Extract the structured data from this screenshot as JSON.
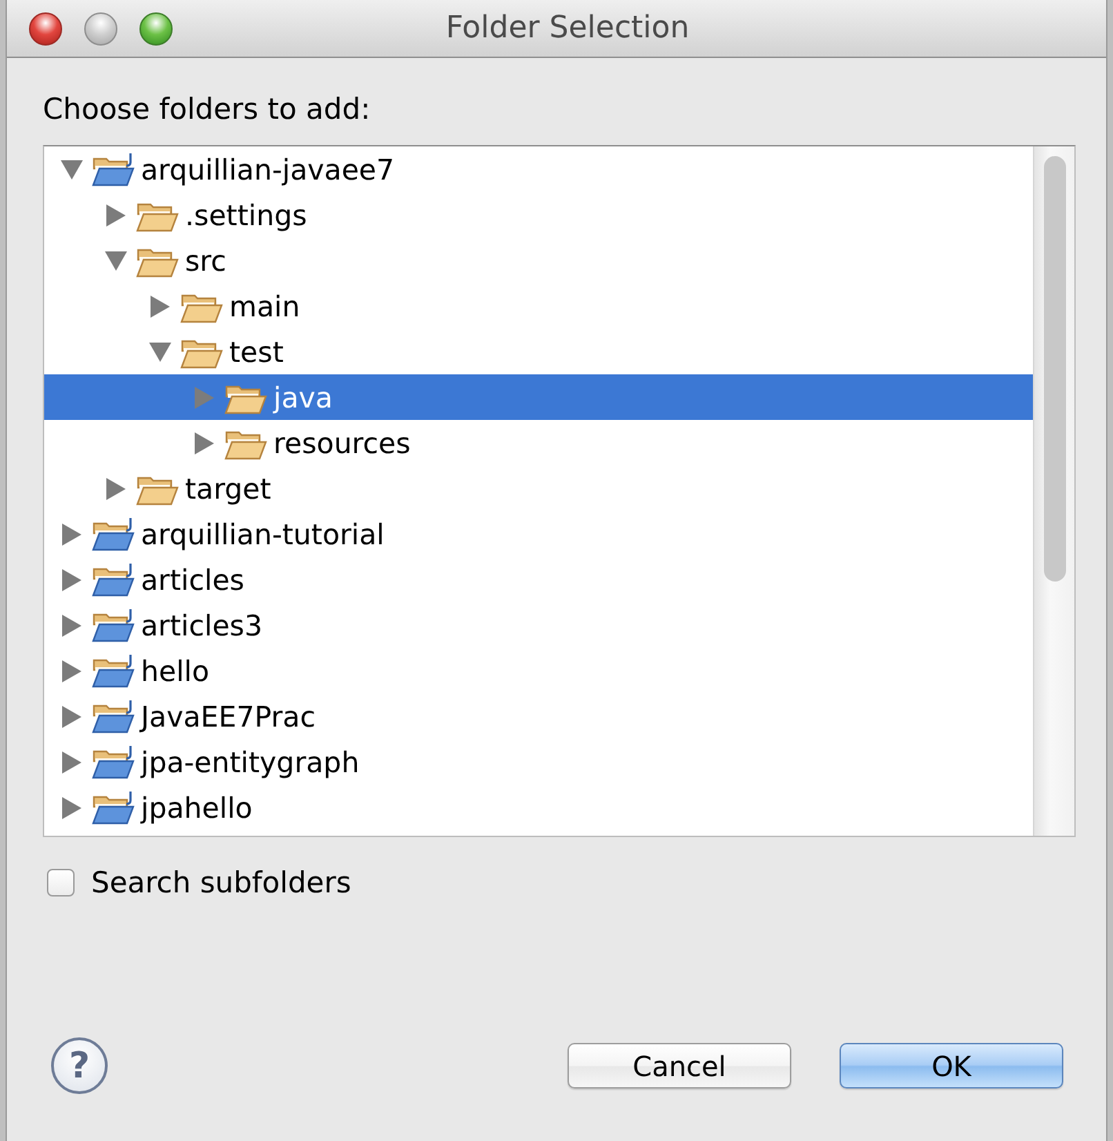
{
  "window": {
    "title": "Folder Selection",
    "controls": [
      {
        "kind": "close",
        "disabled": false
      },
      {
        "kind": "minimize",
        "disabled": true
      },
      {
        "kind": "zoom",
        "disabled": false
      }
    ]
  },
  "prompt": "Choose folders to add:",
  "tree": {
    "items": [
      {
        "label": "arquillian-javaee7",
        "kind": "project",
        "expanded": true,
        "selected": false,
        "children": [
          {
            "label": ".settings",
            "kind": "folder",
            "expanded": false,
            "selected": false
          },
          {
            "label": "src",
            "kind": "folder",
            "expanded": true,
            "selected": false,
            "children": [
              {
                "label": "main",
                "kind": "folder",
                "expanded": false,
                "selected": false
              },
              {
                "label": "test",
                "kind": "folder",
                "expanded": true,
                "selected": false,
                "children": [
                  {
                    "label": "java",
                    "kind": "folder",
                    "expanded": false,
                    "selected": true
                  },
                  {
                    "label": "resources",
                    "kind": "folder",
                    "expanded": false,
                    "selected": false
                  }
                ]
              }
            ]
          },
          {
            "label": "target",
            "kind": "folder",
            "expanded": false,
            "selected": false
          }
        ]
      },
      {
        "label": "arquillian-tutorial",
        "kind": "project",
        "expanded": false,
        "selected": false
      },
      {
        "label": "articles",
        "kind": "project",
        "expanded": false,
        "selected": false
      },
      {
        "label": "articles3",
        "kind": "project",
        "expanded": false,
        "selected": false
      },
      {
        "label": "hello",
        "kind": "project",
        "expanded": false,
        "selected": false
      },
      {
        "label": "JavaEE7Prac",
        "kind": "project",
        "expanded": false,
        "selected": false
      },
      {
        "label": "jpa-entitygraph",
        "kind": "project",
        "expanded": false,
        "selected": false
      },
      {
        "label": "jpahello",
        "kind": "project",
        "expanded": false,
        "selected": false
      }
    ]
  },
  "search_subfolders": {
    "label": "Search subfolders",
    "checked": false
  },
  "help": {
    "glyph": "?"
  },
  "buttons": [
    {
      "label": "Cancel",
      "default": false
    },
    {
      "label": "OK",
      "default": true
    }
  ]
}
